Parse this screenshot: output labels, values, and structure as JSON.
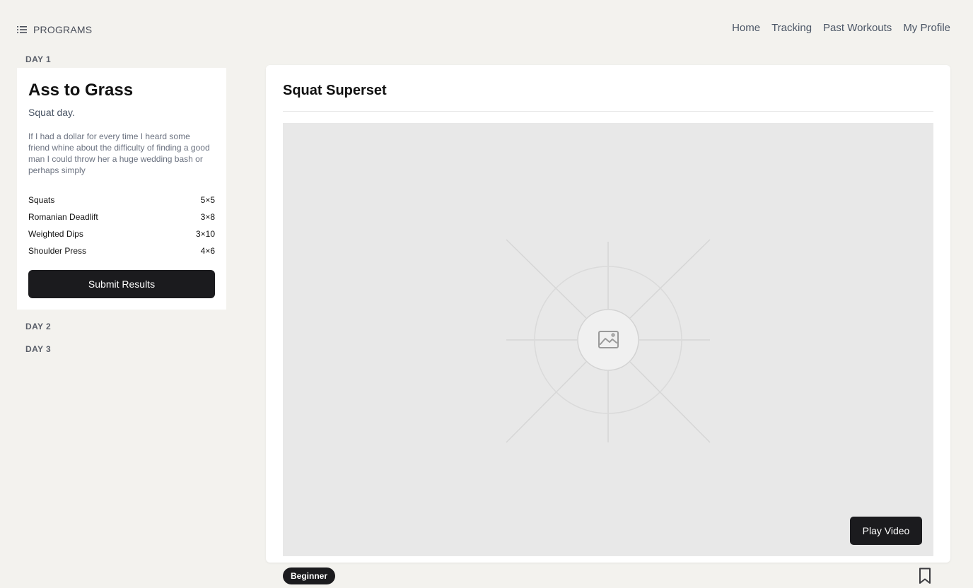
{
  "topbar": {
    "programs_label": "PROGRAMS",
    "programs_icon": "list-icon",
    "nav": [
      "Home",
      "Tracking",
      "Past Workouts",
      "My Profile"
    ]
  },
  "sidebar": {
    "days": [
      "DAY 1",
      "DAY 2",
      "DAY 3"
    ],
    "active_day": {
      "title": "Ass to Grass",
      "subtitle": "Squat day.",
      "description": "If I had a dollar for every time I heard some friend whine about the difficulty of finding a good man I could throw her a huge wedding bash or perhaps simply",
      "exercises": [
        {
          "name": "Squats",
          "sets": "5×5"
        },
        {
          "name": "Romanian Deadlift",
          "sets": "3×8"
        },
        {
          "name": "Weighted Dips",
          "sets": "3×10"
        },
        {
          "name": "Shoulder Press",
          "sets": "4×6"
        }
      ],
      "submit_label": "Submit Results"
    }
  },
  "main": {
    "title": "Squat Superset",
    "media_icon": "image-placeholder-icon",
    "play_label": "Play Video",
    "level_badge": "Beginner",
    "bookmark_icon": "bookmark-icon"
  },
  "colors": {
    "background": "#f3f2ee",
    "card": "#ffffff",
    "button": "#1b1b1e",
    "media": "#e8e8e8"
  }
}
